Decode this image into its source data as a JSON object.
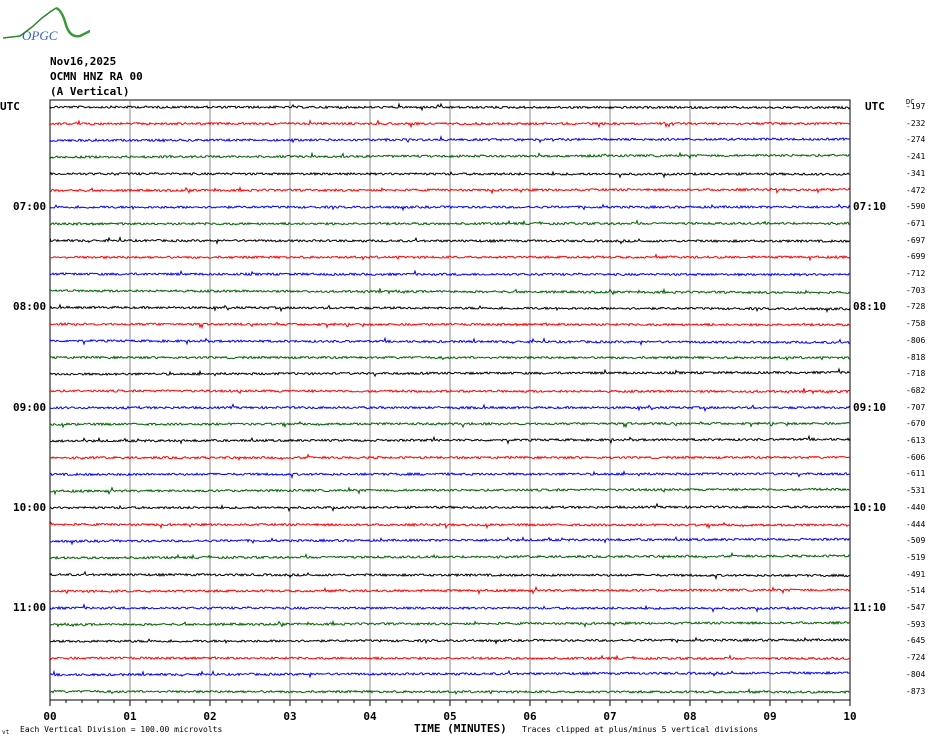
{
  "logo": {
    "text": "OPGC"
  },
  "header": {
    "date": "Nov16,2025",
    "station": "OCMN HNZ RA 00",
    "component": "(A Vertical)"
  },
  "chart_data": {
    "type": "line",
    "title": "OCMN HNZ RA 00 (A Vertical) Nov16,2025",
    "xlabel": "TIME (MINUTES)",
    "xlim": [
      0,
      10
    ],
    "x_ticks": [
      "00",
      "01",
      "02",
      "03",
      "04",
      "05",
      "06",
      "07",
      "08",
      "09",
      "10"
    ],
    "left_label_utc": "UTC",
    "right_label_utc": "UTC",
    "dc_header": "DC",
    "left_time_labels": [
      {
        "trace": 6,
        "label": "07:00"
      },
      {
        "trace": 12,
        "label": "08:00"
      },
      {
        "trace": 18,
        "label": "09:00"
      },
      {
        "trace": 24,
        "label": "10:00"
      },
      {
        "trace": 30,
        "label": "11:00"
      }
    ],
    "right_time_labels": [
      {
        "trace": 6,
        "label": "07:10"
      },
      {
        "trace": 12,
        "label": "08:10"
      },
      {
        "trace": 18,
        "label": "09:10"
      },
      {
        "trace": 24,
        "label": "10:10"
      },
      {
        "trace": 30,
        "label": "11:10"
      }
    ],
    "trace_colors": [
      "#000000",
      "#ff0000",
      "#0000ff",
      "#006400"
    ],
    "dc_offsets": [
      "-197",
      "-232",
      "-274",
      "-241",
      "-341",
      "-472",
      "-590",
      "-671",
      "-697",
      "-699",
      "-712",
      "-703",
      "-728",
      "-758",
      "-806",
      "-818",
      "-718",
      "-682",
      "-707",
      "-670",
      "-613",
      "-606",
      "-611",
      "-531",
      "-440",
      "-444",
      "-509",
      "-519",
      "-491",
      "-514",
      "-547",
      "-593",
      "-645",
      "-724",
      "-804",
      "-873"
    ],
    "scale_note": "Each Vertical Division =  100.00 microvolts",
    "clip_note": "Traces clipped at plus/minus 5 vertical divisions",
    "corner_mark": "vt"
  }
}
